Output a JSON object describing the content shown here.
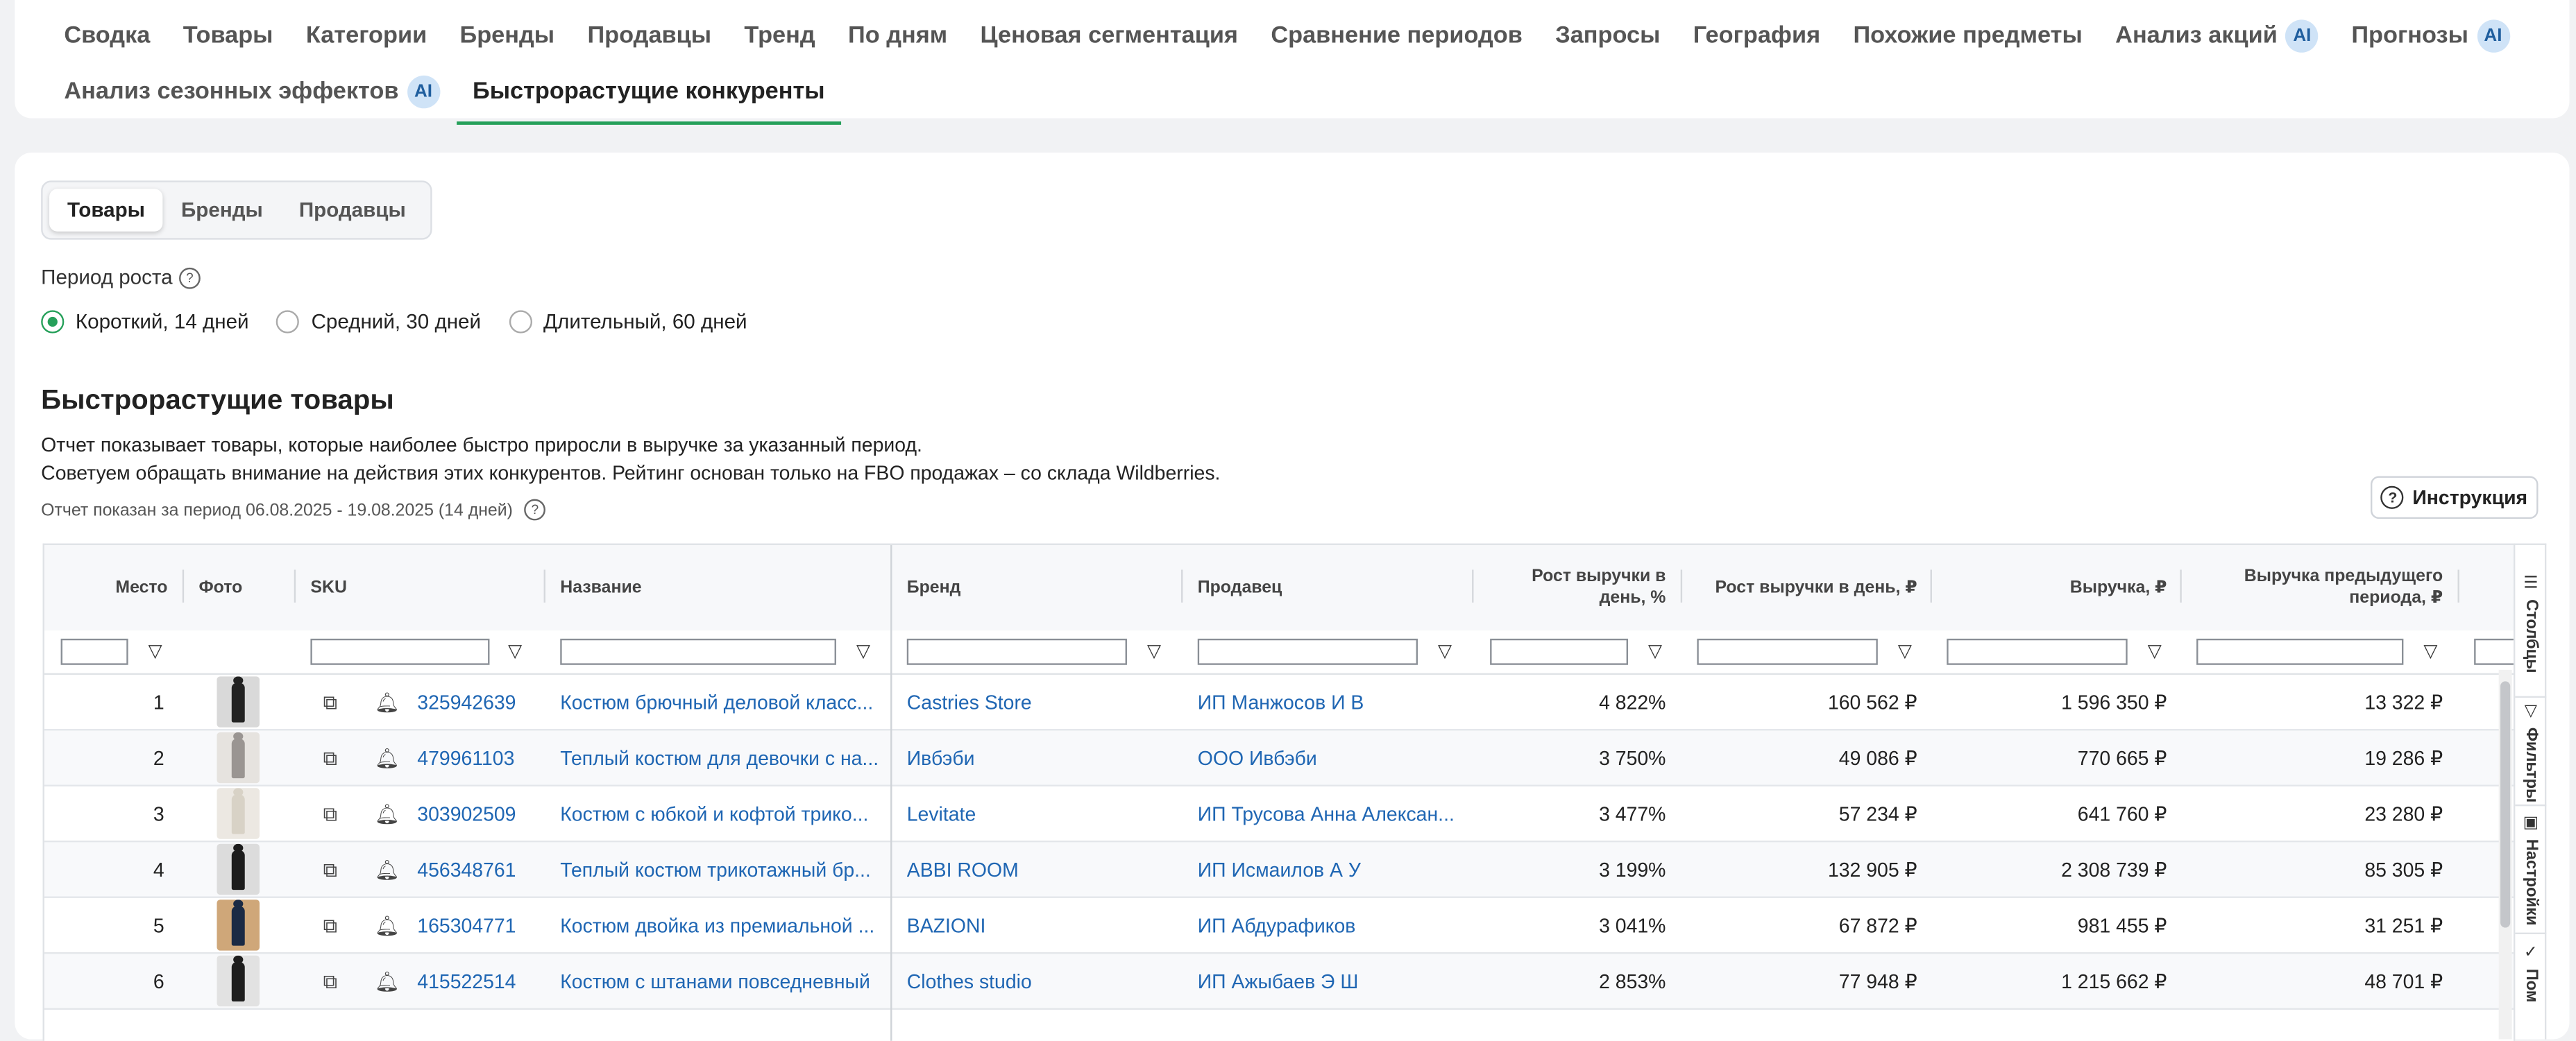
{
  "nav": {
    "row1": [
      {
        "label": "Сводка",
        "ai": false
      },
      {
        "label": "Товары",
        "ai": false
      },
      {
        "label": "Категории",
        "ai": false
      },
      {
        "label": "Бренды",
        "ai": false
      },
      {
        "label": "Продавцы",
        "ai": false
      },
      {
        "label": "Тренд",
        "ai": false
      },
      {
        "label": "По дням",
        "ai": false
      },
      {
        "label": "Ценовая сегментация",
        "ai": false
      },
      {
        "label": "Сравнение периодов",
        "ai": false
      },
      {
        "label": "Запросы",
        "ai": false
      },
      {
        "label": "География",
        "ai": false
      },
      {
        "label": "Похожие предметы",
        "ai": false
      },
      {
        "label": "Анализ акций",
        "ai": true
      },
      {
        "label": "Прогнозы",
        "ai": true
      }
    ],
    "row2": [
      {
        "label": "Анализ сезонных эффектов",
        "ai": true
      },
      {
        "label": "Быстрорастущие конкуренты",
        "ai": false,
        "active": true
      }
    ],
    "ai_badge": "AI"
  },
  "segment": {
    "items": [
      "Товары",
      "Бренды",
      "Продавцы"
    ],
    "active": 0
  },
  "period": {
    "label": "Период роста",
    "options": [
      "Короткий, 14 дней",
      "Средний, 30 дней",
      "Длительный, 60 дней"
    ],
    "selected": 0
  },
  "section": {
    "title": "Быстрорастущие товары",
    "desc1": "Отчет показывает товары, которые наиболее быстро приросли в выручке за указанный период.",
    "desc2": "Советуем обращать внимание на действия этих конкурентов. Рейтинг основан только на FBO продажах – со склада Wildberries.",
    "period_note": "Отчет показан за период 06.08.2025 - 19.08.2025 (14 дней)",
    "instruction_button": "Инструкция"
  },
  "table": {
    "headers": {
      "place": "Место",
      "photo": "Фото",
      "sku": "SKU",
      "name": "Название",
      "brand": "Бренд",
      "seller": "Продавец",
      "growth_pct": "Рост выручки в день, %",
      "growth_rub": "Рост выручки в день, ₽",
      "revenue": "Выручка, ₽",
      "prev_revenue": "Выручка предыдущего периода, ₽"
    },
    "rows": [
      {
        "place": "1",
        "sku": "325942639",
        "name": "Костюм брючный деловой класс...",
        "brand": "Castries Store",
        "seller": "ИП Манжосов И В",
        "growth_pct": "4 822%",
        "growth_rub": "160 562 ₽",
        "revenue": "1 596 350 ₽",
        "prev_revenue": "13 322 ₽"
      },
      {
        "place": "2",
        "sku": "479961103",
        "name": "Теплый костюм для девочки с на...",
        "brand": "Ивбэби",
        "seller": "ООО Ивбэби",
        "growth_pct": "3 750%",
        "growth_rub": "49 086 ₽",
        "revenue": "770 665 ₽",
        "prev_revenue": "19 286 ₽"
      },
      {
        "place": "3",
        "sku": "303902509",
        "name": "Костюм с юбкой и кофтой трико...",
        "brand": "Levitate",
        "seller": "ИП Трусова Анна Алексан...",
        "growth_pct": "3 477%",
        "growth_rub": "57 234 ₽",
        "revenue": "641 760 ₽",
        "prev_revenue": "23 280 ₽"
      },
      {
        "place": "4",
        "sku": "456348761",
        "name": "Теплый костюм трикотажный бр...",
        "brand": "ABBI ROOM",
        "seller": "ИП Исмаилов А У",
        "growth_pct": "3 199%",
        "growth_rub": "132 905 ₽",
        "revenue": "2 308 739 ₽",
        "prev_revenue": "85 305 ₽"
      },
      {
        "place": "5",
        "sku": "165304771",
        "name": "Костюм двойка из премиальной ...",
        "brand": "BAZIONI",
        "seller": "ИП Абдурафиков",
        "growth_pct": "3 041%",
        "growth_rub": "67 872 ₽",
        "revenue": "981 455 ₽",
        "prev_revenue": "31 251 ₽"
      },
      {
        "place": "6",
        "sku": "415522514",
        "name": "Костюм с штанами повседневный",
        "brand": "Clothes studio",
        "seller": "ИП Ажыбаев Э Ш",
        "growth_pct": "2 853%",
        "growth_rub": "77 948 ₽",
        "revenue": "1 215 662 ₽",
        "prev_revenue": "48 701 ₽"
      }
    ]
  },
  "sidetabs": [
    "Столбцы",
    "Фильтры",
    "Настройки",
    "Пом"
  ],
  "colors": {
    "accent": "#26a05a",
    "link": "#1f66b3",
    "ai_bg": "#cfe3f7"
  }
}
